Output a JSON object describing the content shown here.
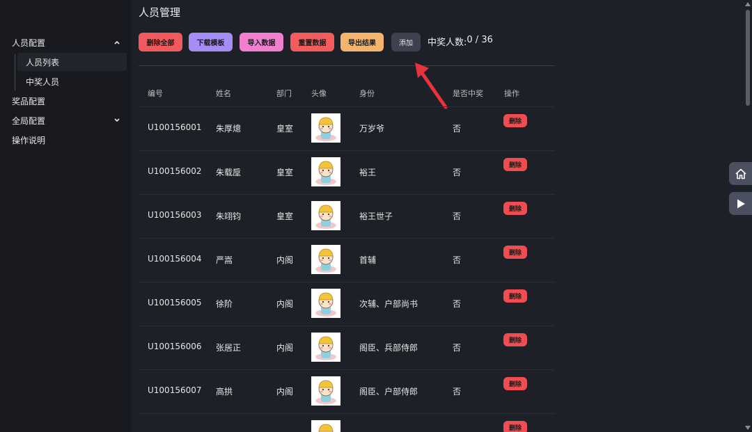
{
  "page": {
    "title": "人员管理"
  },
  "sidebar": {
    "groups": [
      {
        "label": "人员配置",
        "expanded": true,
        "icon": "chevron-up-icon"
      },
      {
        "label": "奖品配置"
      },
      {
        "label": "全局配置",
        "expanded": false,
        "icon": "chevron-down-icon"
      },
      {
        "label": "操作说明"
      }
    ],
    "sub_items": [
      {
        "label": "人员列表",
        "active": true
      },
      {
        "label": "中奖人员",
        "active": false
      }
    ]
  },
  "toolbar": {
    "delete_all": "删除全部",
    "download_template": "下载模板",
    "import_data": "导入数据",
    "reset_data": "重置数据",
    "export_results": "导出结果",
    "add": "添加",
    "winner_label": "中奖人数:",
    "winner_count": "0",
    "winner_sep": " / ",
    "winner_total": "36"
  },
  "table": {
    "headers": {
      "id": "编号",
      "name": "姓名",
      "dept": "部门",
      "avatar": "头像",
      "identity": "身份",
      "won": "是否中奖",
      "action": "操作"
    },
    "delete_label": "删除",
    "rows": [
      {
        "id": "U100156001",
        "name": "朱厚熜",
        "dept": "皇室",
        "identity": "万岁爷",
        "won": "否"
      },
      {
        "id": "U100156002",
        "name": "朱载垕",
        "dept": "皇室",
        "identity": "裕王",
        "won": "否"
      },
      {
        "id": "U100156003",
        "name": "朱翊钧",
        "dept": "皇室",
        "identity": "裕王世子",
        "won": "否"
      },
      {
        "id": "U100156004",
        "name": "严嵩",
        "dept": "内阁",
        "identity": "首辅",
        "won": "否"
      },
      {
        "id": "U100156005",
        "name": "徐阶",
        "dept": "内阁",
        "identity": "次辅、户部尚书",
        "won": "否"
      },
      {
        "id": "U100156006",
        "name": "张居正",
        "dept": "内阁",
        "identity": "阁臣、兵部侍郎",
        "won": "否"
      },
      {
        "id": "U100156007",
        "name": "高拱",
        "dept": "内阁",
        "identity": "阁臣、户部侍郎",
        "won": "否"
      },
      {
        "id": "",
        "name": "",
        "dept": "",
        "identity": "",
        "won": ""
      }
    ]
  },
  "float_buttons": [
    {
      "icon": "home-icon"
    },
    {
      "icon": "play-icon"
    }
  ],
  "colors": {
    "accent_red": "#f04d52",
    "annotation_arrow": "#e8323c"
  }
}
